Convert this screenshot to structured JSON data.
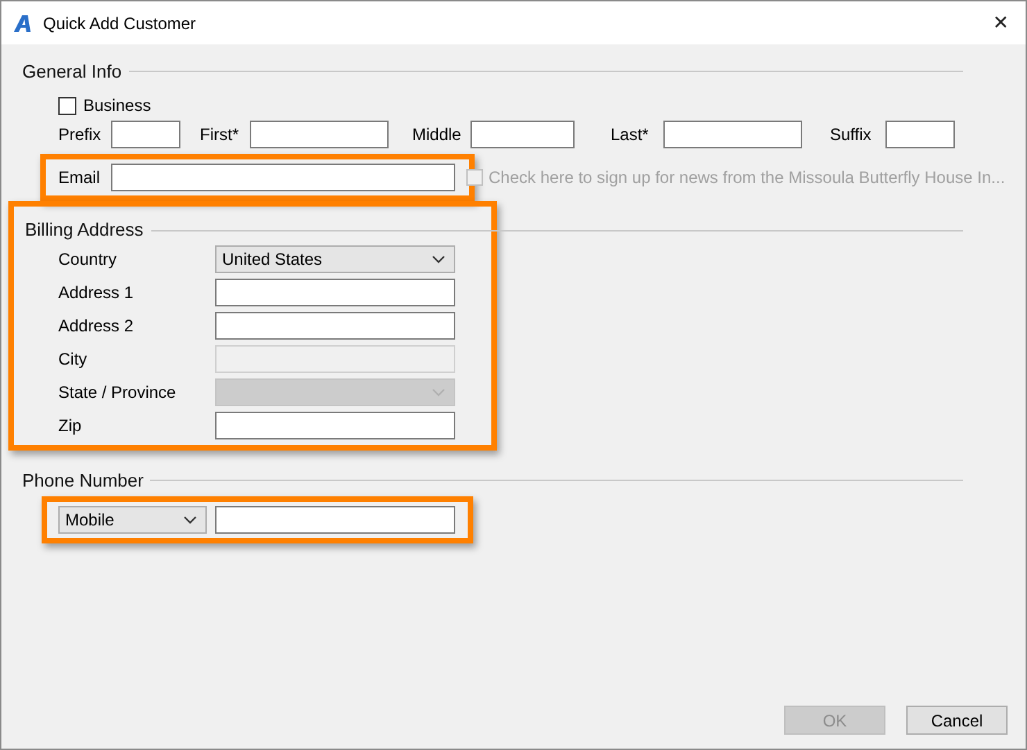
{
  "window": {
    "title": "Quick Add Customer",
    "close": "✕"
  },
  "general_info": {
    "legend": "General Info",
    "business": {
      "label": "Business",
      "checked": false
    },
    "name_fields": [
      {
        "label": "Prefix"
      },
      {
        "label": "First*"
      },
      {
        "label": "Middle"
      },
      {
        "label": "Last*"
      },
      {
        "label": "Suffix"
      }
    ],
    "email": {
      "label": "Email",
      "highlighted": true
    },
    "newsletter": {
      "label": "Check here to sign up for news from the Missoula Butterfly House  In...",
      "checked": false,
      "disabled": true
    }
  },
  "billing_address": {
    "legend": "Billing Address",
    "highlighted": true,
    "fields": [
      {
        "label": "Country",
        "kind": "dropdown",
        "value": "United States",
        "disabled": false
      },
      {
        "label": "Address 1",
        "kind": "text",
        "disabled": false
      },
      {
        "label": "Address 2",
        "kind": "text",
        "disabled": false
      },
      {
        "label": "City",
        "kind": "text",
        "disabled": true
      },
      {
        "label": "State / Province",
        "kind": "dropdown",
        "disabled": true
      },
      {
        "label": "Zip",
        "kind": "text",
        "disabled": false
      }
    ]
  },
  "phone_number": {
    "legend": "Phone Number",
    "type": "Mobile",
    "highlighted": true
  },
  "buttons": [
    {
      "label": "OK",
      "disabled": true
    },
    {
      "label": "Cancel",
      "disabled": false
    }
  ]
}
